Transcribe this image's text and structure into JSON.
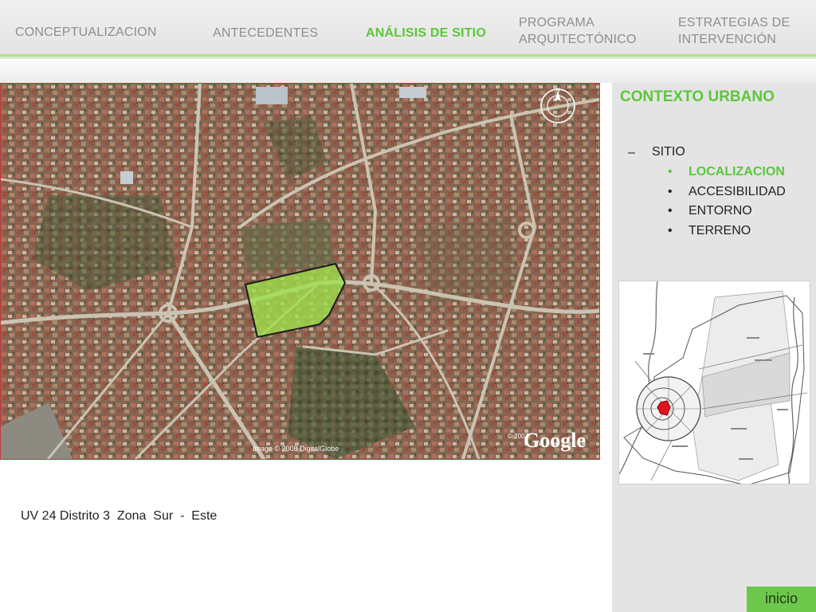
{
  "nav": {
    "items": [
      {
        "label": "CONCEPTUALIZACION"
      },
      {
        "label": "ANTECEDENTES"
      },
      {
        "label": "ANÁLISIS DE SITIO"
      },
      {
        "label_line1": "PROGRAMA",
        "label_line2": "ARQUITECTÓNICO"
      },
      {
        "label_line1": "ESTRATEGIAS DE",
        "label_line2": "INTERVENCIÓN"
      }
    ]
  },
  "sidebar": {
    "title": "CONTEXTO URBANO",
    "dash": "–",
    "section": "SITIO",
    "bullet": "•",
    "items": [
      {
        "label": "LOCALIZACION"
      },
      {
        "label": "ACCESIBILIDAD"
      },
      {
        "label": "ENTORNO"
      },
      {
        "label": "TERRENO"
      }
    ]
  },
  "satellite": {
    "credit": "Image © 2008 DigitalGlobe",
    "brand": "Google",
    "copyright": "© 2007"
  },
  "caption": "UV 24 Distrito 3  Zona  Sur  -  Este",
  "inicio_label": "inicio",
  "colors": {
    "accent_green": "#5cc63b",
    "site_polygon": "#9ee04a",
    "image_border": "#c43a3a",
    "inset_marker": "#e0141c"
  }
}
